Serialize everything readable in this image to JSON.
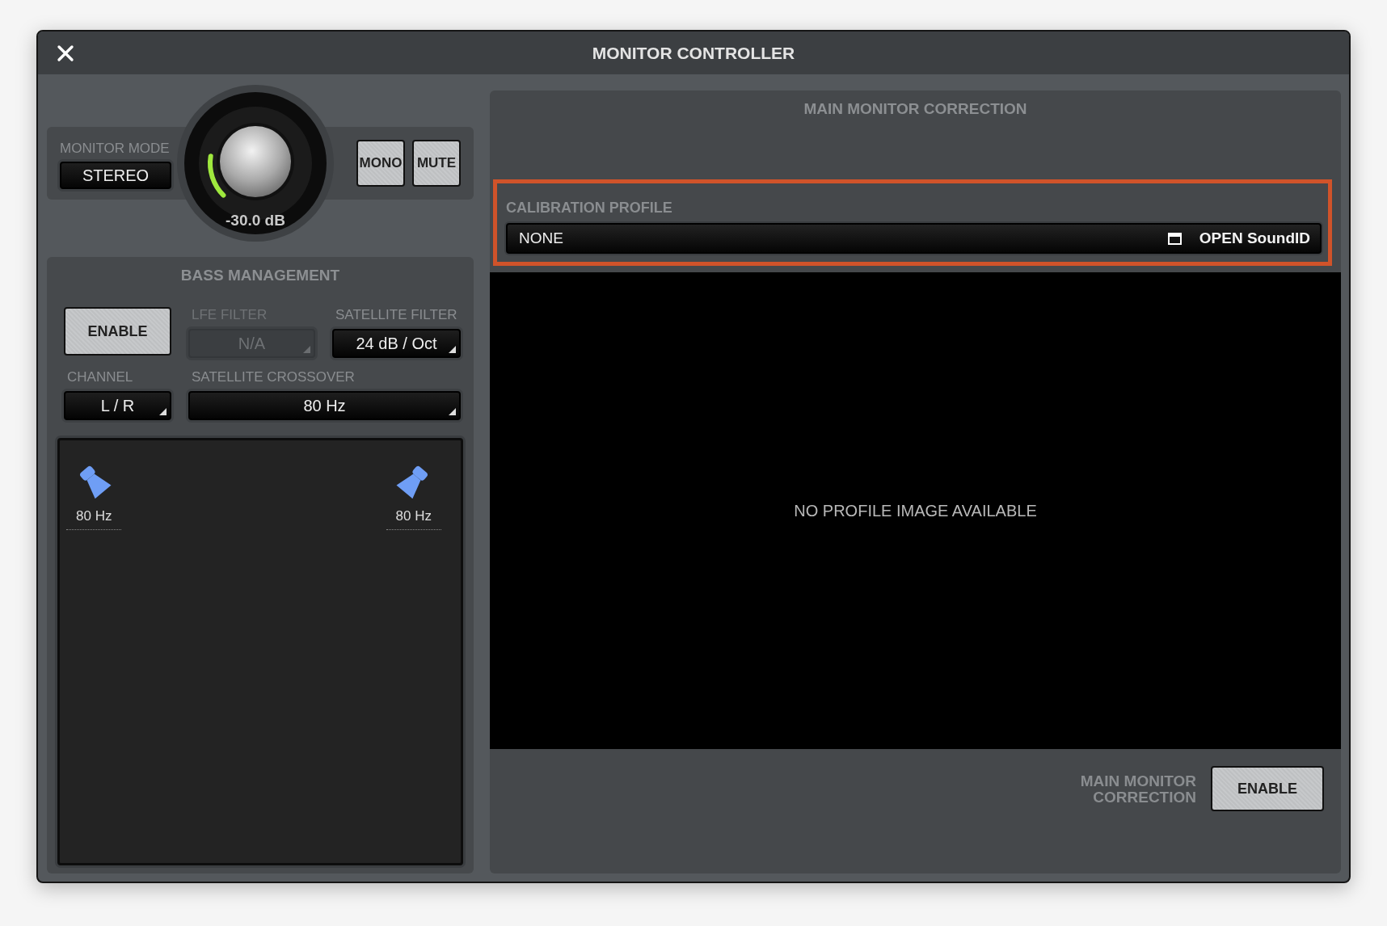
{
  "window": {
    "title": "MONITOR CONTROLLER"
  },
  "monitor_mode": {
    "label": "MONITOR MODE",
    "value": "STEREO"
  },
  "volume": {
    "reading": "-30.0 dB",
    "level": 0.2
  },
  "buttons": [
    {
      "label": "MONO"
    },
    {
      "label": "MUTE"
    }
  ],
  "bass_management": {
    "title": "BASS MANAGEMENT",
    "enable_button": "ENABLE",
    "fields": [
      {
        "label": "LFE FILTER",
        "value": "N/A",
        "disabled": true
      },
      {
        "label": "SATELLITE FILTER",
        "value": "24 dB / Oct",
        "disabled": false
      },
      {
        "label": "CHANNEL",
        "value": "L / R",
        "disabled": false
      },
      {
        "label": "SATELLITE CROSSOVER",
        "value": "80 Hz",
        "disabled": false
      }
    ],
    "speakers": [
      {
        "kind": "left",
        "frequency": "80 Hz"
      },
      {
        "kind": "right",
        "frequency": "80 Hz"
      }
    ]
  },
  "main_monitor_correction": {
    "title": "MAIN MONITOR CORRECTION",
    "calibration_profile": {
      "label": "CALIBRATION PROFILE",
      "value": "NONE",
      "action": "OPEN SoundID",
      "highlighted": true
    },
    "image_message": "NO PROFILE IMAGE AVAILABLE",
    "enable_label": "MAIN MONITOR CORRECTION",
    "enable_button": "ENABLE"
  }
}
